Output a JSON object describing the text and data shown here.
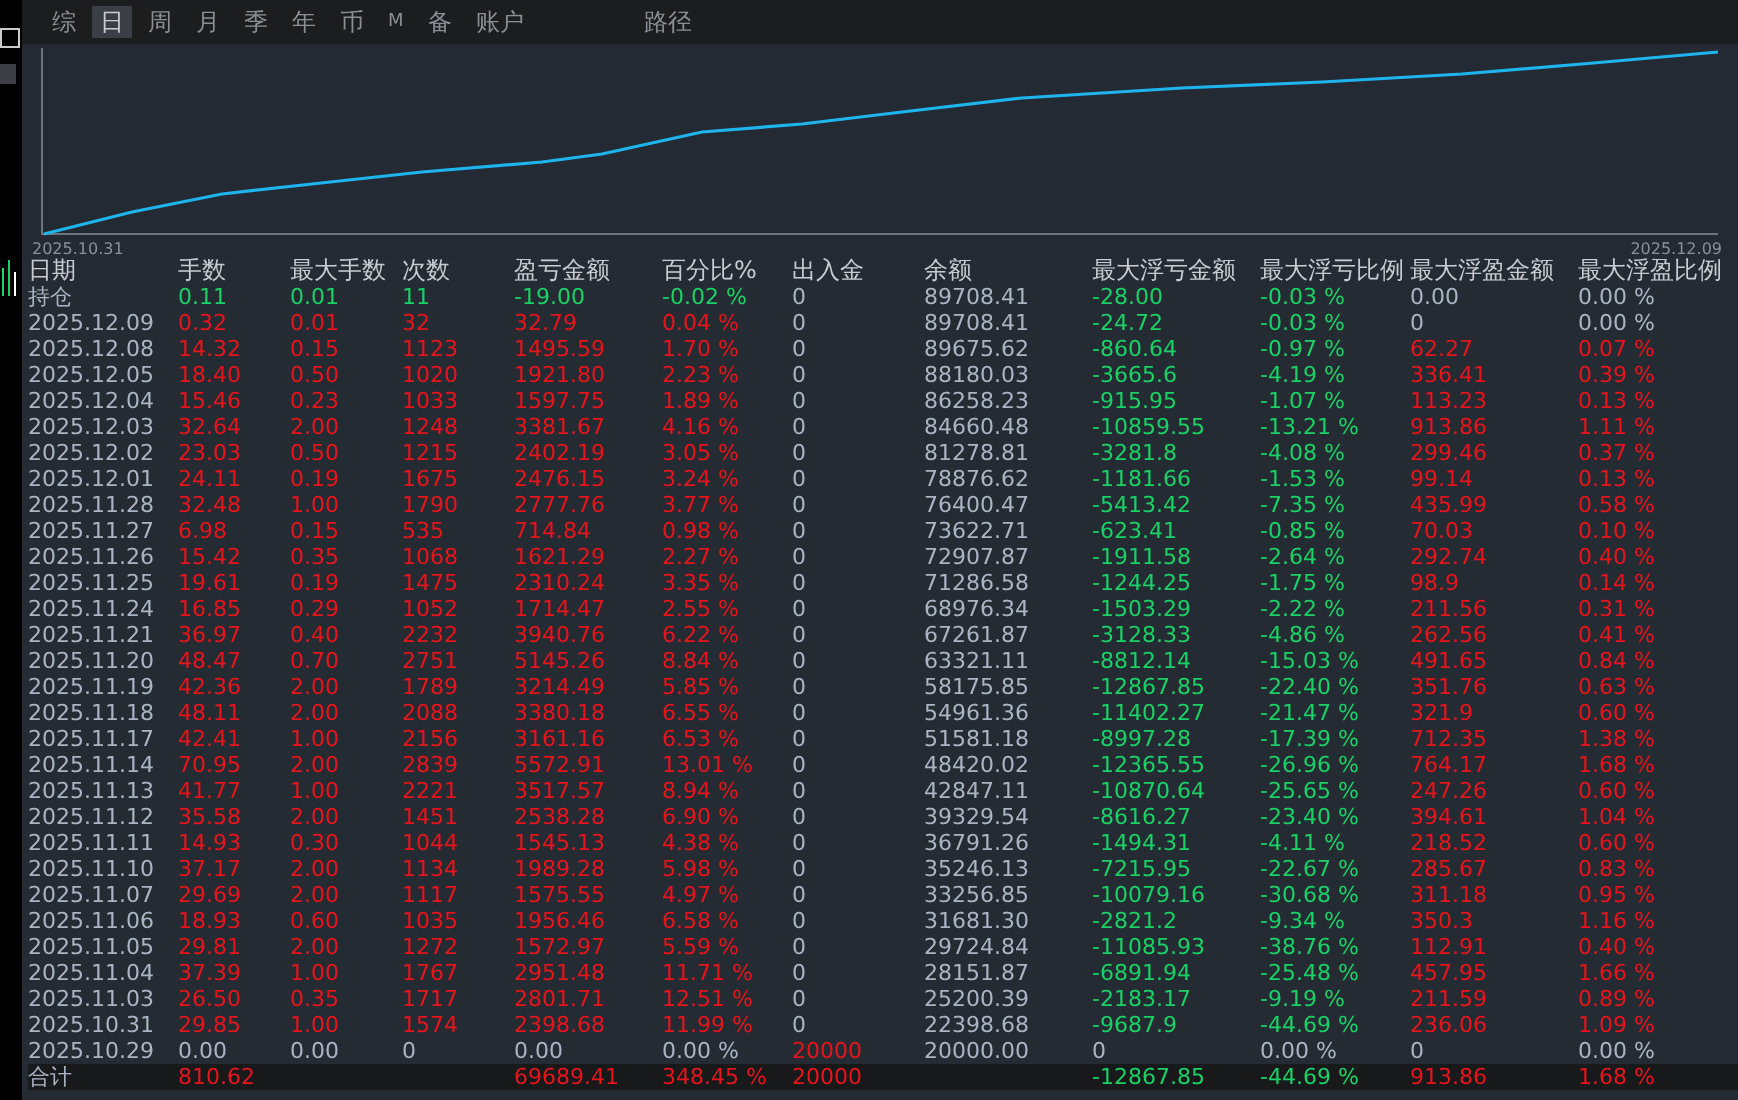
{
  "tabs": [
    {
      "label": "综",
      "selected": false
    },
    {
      "label": "日",
      "selected": true
    },
    {
      "label": "周",
      "selected": false
    },
    {
      "label": "月",
      "selected": false
    },
    {
      "label": "季",
      "selected": false
    },
    {
      "label": "年",
      "selected": false
    },
    {
      "label": "币",
      "selected": false
    },
    {
      "label": "M",
      "selected": false
    },
    {
      "label": "备",
      "selected": false
    },
    {
      "label": "账户",
      "selected": false
    }
  ],
  "path_tab": {
    "label": "路径",
    "selected": false
  },
  "chart": {
    "start_label": "2025.10.31",
    "end_label": "2025.12.09"
  },
  "table": {
    "columns": [
      "日期",
      "手数",
      "最大手数",
      "次数",
      "盈亏金额",
      "百分比%",
      "出入金",
      "余额",
      "最大浮亏金额",
      "最大浮亏比例",
      "最大浮盈金额",
      "最大浮盈比例"
    ],
    "rows": [
      {
        "cells": [
          {
            "text": "持仓",
            "color": "#aab4c4"
          },
          {
            "text": "0.11",
            "color": "#1ad166"
          },
          {
            "text": "0.01",
            "color": "#1ad166"
          },
          {
            "text": "11",
            "color": "#1ad166"
          },
          {
            "text": "-19.00",
            "color": "#1ad166"
          },
          {
            "text": "-0.02 %",
            "color": "#1ad166"
          },
          {
            "text": "0",
            "color": "#aab4c4"
          },
          {
            "text": "89708.41",
            "color": "#aab4c4"
          },
          {
            "text": "-28.00",
            "color": "#1ad166"
          },
          {
            "text": "-0.03 %",
            "color": "#1ad166"
          },
          {
            "text": "0.00",
            "color": "#aab4c4"
          },
          {
            "text": "0.00 %",
            "color": "#aab4c4"
          }
        ]
      },
      {
        "cells": [
          {
            "text": "2025.12.09",
            "color": "#aab4c4"
          },
          {
            "text": "0.32",
            "color": "#e8141c"
          },
          {
            "text": "0.01",
            "color": "#e8141c"
          },
          {
            "text": "32",
            "color": "#e8141c"
          },
          {
            "text": "32.79",
            "color": "#e8141c"
          },
          {
            "text": "0.04 %",
            "color": "#e8141c"
          },
          {
            "text": "0",
            "color": "#aab4c4"
          },
          {
            "text": "89708.41",
            "color": "#aab4c4"
          },
          {
            "text": "-24.72",
            "color": "#1ad166"
          },
          {
            "text": "-0.03 %",
            "color": "#1ad166"
          },
          {
            "text": "0",
            "color": "#aab4c4"
          },
          {
            "text": "0.00 %",
            "color": "#aab4c4"
          }
        ]
      },
      {
        "cells": [
          {
            "text": "2025.12.08",
            "color": "#aab4c4"
          },
          {
            "text": "14.32",
            "color": "#e8141c"
          },
          {
            "text": "0.15",
            "color": "#e8141c"
          },
          {
            "text": "1123",
            "color": "#e8141c"
          },
          {
            "text": "1495.59",
            "color": "#e8141c"
          },
          {
            "text": "1.70 %",
            "color": "#e8141c"
          },
          {
            "text": "0",
            "color": "#aab4c4"
          },
          {
            "text": "89675.62",
            "color": "#aab4c4"
          },
          {
            "text": "-860.64",
            "color": "#1ad166"
          },
          {
            "text": "-0.97 %",
            "color": "#1ad166"
          },
          {
            "text": "62.27",
            "color": "#e8141c"
          },
          {
            "text": "0.07 %",
            "color": "#e8141c"
          }
        ]
      },
      {
        "cells": [
          {
            "text": "2025.12.05",
            "color": "#aab4c4"
          },
          {
            "text": "18.40",
            "color": "#e8141c"
          },
          {
            "text": "0.50",
            "color": "#e8141c"
          },
          {
            "text": "1020",
            "color": "#e8141c"
          },
          {
            "text": "1921.80",
            "color": "#e8141c"
          },
          {
            "text": "2.23 %",
            "color": "#e8141c"
          },
          {
            "text": "0",
            "color": "#aab4c4"
          },
          {
            "text": "88180.03",
            "color": "#aab4c4"
          },
          {
            "text": "-3665.6",
            "color": "#1ad166"
          },
          {
            "text": "-4.19 %",
            "color": "#1ad166"
          },
          {
            "text": "336.41",
            "color": "#e8141c"
          },
          {
            "text": "0.39 %",
            "color": "#e8141c"
          }
        ]
      },
      {
        "cells": [
          {
            "text": "2025.12.04",
            "color": "#aab4c4"
          },
          {
            "text": "15.46",
            "color": "#e8141c"
          },
          {
            "text": "0.23",
            "color": "#e8141c"
          },
          {
            "text": "1033",
            "color": "#e8141c"
          },
          {
            "text": "1597.75",
            "color": "#e8141c"
          },
          {
            "text": "1.89 %",
            "color": "#e8141c"
          },
          {
            "text": "0",
            "color": "#aab4c4"
          },
          {
            "text": "86258.23",
            "color": "#aab4c4"
          },
          {
            "text": "-915.95",
            "color": "#1ad166"
          },
          {
            "text": "-1.07 %",
            "color": "#1ad166"
          },
          {
            "text": "113.23",
            "color": "#e8141c"
          },
          {
            "text": "0.13 %",
            "color": "#e8141c"
          }
        ]
      },
      {
        "cells": [
          {
            "text": "2025.12.03",
            "color": "#aab4c4"
          },
          {
            "text": "32.64",
            "color": "#e8141c"
          },
          {
            "text": "2.00",
            "color": "#e8141c"
          },
          {
            "text": "1248",
            "color": "#e8141c"
          },
          {
            "text": "3381.67",
            "color": "#e8141c"
          },
          {
            "text": "4.16 %",
            "color": "#e8141c"
          },
          {
            "text": "0",
            "color": "#aab4c4"
          },
          {
            "text": "84660.48",
            "color": "#aab4c4"
          },
          {
            "text": "-10859.55",
            "color": "#1ad166"
          },
          {
            "text": "-13.21 %",
            "color": "#1ad166"
          },
          {
            "text": "913.86",
            "color": "#e8141c"
          },
          {
            "text": "1.11 %",
            "color": "#e8141c"
          }
        ]
      },
      {
        "cells": [
          {
            "text": "2025.12.02",
            "color": "#aab4c4"
          },
          {
            "text": "23.03",
            "color": "#e8141c"
          },
          {
            "text": "0.50",
            "color": "#e8141c"
          },
          {
            "text": "1215",
            "color": "#e8141c"
          },
          {
            "text": "2402.19",
            "color": "#e8141c"
          },
          {
            "text": "3.05 %",
            "color": "#e8141c"
          },
          {
            "text": "0",
            "color": "#aab4c4"
          },
          {
            "text": "81278.81",
            "color": "#aab4c4"
          },
          {
            "text": "-3281.8",
            "color": "#1ad166"
          },
          {
            "text": "-4.08 %",
            "color": "#1ad166"
          },
          {
            "text": "299.46",
            "color": "#e8141c"
          },
          {
            "text": "0.37 %",
            "color": "#e8141c"
          }
        ]
      },
      {
        "cells": [
          {
            "text": "2025.12.01",
            "color": "#aab4c4"
          },
          {
            "text": "24.11",
            "color": "#e8141c"
          },
          {
            "text": "0.19",
            "color": "#e8141c"
          },
          {
            "text": "1675",
            "color": "#e8141c"
          },
          {
            "text": "2476.15",
            "color": "#e8141c"
          },
          {
            "text": "3.24 %",
            "color": "#e8141c"
          },
          {
            "text": "0",
            "color": "#aab4c4"
          },
          {
            "text": "78876.62",
            "color": "#aab4c4"
          },
          {
            "text": "-1181.66",
            "color": "#1ad166"
          },
          {
            "text": "-1.53 %",
            "color": "#1ad166"
          },
          {
            "text": "99.14",
            "color": "#e8141c"
          },
          {
            "text": "0.13 %",
            "color": "#e8141c"
          }
        ]
      },
      {
        "cells": [
          {
            "text": "2025.11.28",
            "color": "#aab4c4"
          },
          {
            "text": "32.48",
            "color": "#e8141c"
          },
          {
            "text": "1.00",
            "color": "#e8141c"
          },
          {
            "text": "1790",
            "color": "#e8141c"
          },
          {
            "text": "2777.76",
            "color": "#e8141c"
          },
          {
            "text": "3.77 %",
            "color": "#e8141c"
          },
          {
            "text": "0",
            "color": "#aab4c4"
          },
          {
            "text": "76400.47",
            "color": "#aab4c4"
          },
          {
            "text": "-5413.42",
            "color": "#1ad166"
          },
          {
            "text": "-7.35 %",
            "color": "#1ad166"
          },
          {
            "text": "435.99",
            "color": "#e8141c"
          },
          {
            "text": "0.58 %",
            "color": "#e8141c"
          }
        ]
      },
      {
        "cells": [
          {
            "text": "2025.11.27",
            "color": "#aab4c4"
          },
          {
            "text": "6.98",
            "color": "#e8141c"
          },
          {
            "text": "0.15",
            "color": "#e8141c"
          },
          {
            "text": "535",
            "color": "#e8141c"
          },
          {
            "text": "714.84",
            "color": "#e8141c"
          },
          {
            "text": "0.98 %",
            "color": "#e8141c"
          },
          {
            "text": "0",
            "color": "#aab4c4"
          },
          {
            "text": "73622.71",
            "color": "#aab4c4"
          },
          {
            "text": "-623.41",
            "color": "#1ad166"
          },
          {
            "text": "-0.85 %",
            "color": "#1ad166"
          },
          {
            "text": "70.03",
            "color": "#e8141c"
          },
          {
            "text": "0.10 %",
            "color": "#e8141c"
          }
        ]
      },
      {
        "cells": [
          {
            "text": "2025.11.26",
            "color": "#aab4c4"
          },
          {
            "text": "15.42",
            "color": "#e8141c"
          },
          {
            "text": "0.35",
            "color": "#e8141c"
          },
          {
            "text": "1068",
            "color": "#e8141c"
          },
          {
            "text": "1621.29",
            "color": "#e8141c"
          },
          {
            "text": "2.27 %",
            "color": "#e8141c"
          },
          {
            "text": "0",
            "color": "#aab4c4"
          },
          {
            "text": "72907.87",
            "color": "#aab4c4"
          },
          {
            "text": "-1911.58",
            "color": "#1ad166"
          },
          {
            "text": "-2.64 %",
            "color": "#1ad166"
          },
          {
            "text": "292.74",
            "color": "#e8141c"
          },
          {
            "text": "0.40 %",
            "color": "#e8141c"
          }
        ]
      },
      {
        "cells": [
          {
            "text": "2025.11.25",
            "color": "#aab4c4"
          },
          {
            "text": "19.61",
            "color": "#e8141c"
          },
          {
            "text": "0.19",
            "color": "#e8141c"
          },
          {
            "text": "1475",
            "color": "#e8141c"
          },
          {
            "text": "2310.24",
            "color": "#e8141c"
          },
          {
            "text": "3.35 %",
            "color": "#e8141c"
          },
          {
            "text": "0",
            "color": "#aab4c4"
          },
          {
            "text": "71286.58",
            "color": "#aab4c4"
          },
          {
            "text": "-1244.25",
            "color": "#1ad166"
          },
          {
            "text": "-1.75 %",
            "color": "#1ad166"
          },
          {
            "text": "98.9",
            "color": "#e8141c"
          },
          {
            "text": "0.14 %",
            "color": "#e8141c"
          }
        ]
      },
      {
        "cells": [
          {
            "text": "2025.11.24",
            "color": "#aab4c4"
          },
          {
            "text": "16.85",
            "color": "#e8141c"
          },
          {
            "text": "0.29",
            "color": "#e8141c"
          },
          {
            "text": "1052",
            "color": "#e8141c"
          },
          {
            "text": "1714.47",
            "color": "#e8141c"
          },
          {
            "text": "2.55 %",
            "color": "#e8141c"
          },
          {
            "text": "0",
            "color": "#aab4c4"
          },
          {
            "text": "68976.34",
            "color": "#aab4c4"
          },
          {
            "text": "-1503.29",
            "color": "#1ad166"
          },
          {
            "text": "-2.22 %",
            "color": "#1ad166"
          },
          {
            "text": "211.56",
            "color": "#e8141c"
          },
          {
            "text": "0.31 %",
            "color": "#e8141c"
          }
        ]
      },
      {
        "cells": [
          {
            "text": "2025.11.21",
            "color": "#aab4c4"
          },
          {
            "text": "36.97",
            "color": "#e8141c"
          },
          {
            "text": "0.40",
            "color": "#e8141c"
          },
          {
            "text": "2232",
            "color": "#e8141c"
          },
          {
            "text": "3940.76",
            "color": "#e8141c"
          },
          {
            "text": "6.22 %",
            "color": "#e8141c"
          },
          {
            "text": "0",
            "color": "#aab4c4"
          },
          {
            "text": "67261.87",
            "color": "#aab4c4"
          },
          {
            "text": "-3128.33",
            "color": "#1ad166"
          },
          {
            "text": "-4.86 %",
            "color": "#1ad166"
          },
          {
            "text": "262.56",
            "color": "#e8141c"
          },
          {
            "text": "0.41 %",
            "color": "#e8141c"
          }
        ]
      },
      {
        "cells": [
          {
            "text": "2025.11.20",
            "color": "#aab4c4"
          },
          {
            "text": "48.47",
            "color": "#e8141c"
          },
          {
            "text": "0.70",
            "color": "#e8141c"
          },
          {
            "text": "2751",
            "color": "#e8141c"
          },
          {
            "text": "5145.26",
            "color": "#e8141c"
          },
          {
            "text": "8.84 %",
            "color": "#e8141c"
          },
          {
            "text": "0",
            "color": "#aab4c4"
          },
          {
            "text": "63321.11",
            "color": "#aab4c4"
          },
          {
            "text": "-8812.14",
            "color": "#1ad166"
          },
          {
            "text": "-15.03 %",
            "color": "#1ad166"
          },
          {
            "text": "491.65",
            "color": "#e8141c"
          },
          {
            "text": "0.84 %",
            "color": "#e8141c"
          }
        ]
      },
      {
        "cells": [
          {
            "text": "2025.11.19",
            "color": "#aab4c4"
          },
          {
            "text": "42.36",
            "color": "#e8141c"
          },
          {
            "text": "2.00",
            "color": "#e8141c"
          },
          {
            "text": "1789",
            "color": "#e8141c"
          },
          {
            "text": "3214.49",
            "color": "#e8141c"
          },
          {
            "text": "5.85 %",
            "color": "#e8141c"
          },
          {
            "text": "0",
            "color": "#aab4c4"
          },
          {
            "text": "58175.85",
            "color": "#aab4c4"
          },
          {
            "text": "-12867.85",
            "color": "#1ad166"
          },
          {
            "text": "-22.40 %",
            "color": "#1ad166"
          },
          {
            "text": "351.76",
            "color": "#e8141c"
          },
          {
            "text": "0.63 %",
            "color": "#e8141c"
          }
        ]
      },
      {
        "cells": [
          {
            "text": "2025.11.18",
            "color": "#aab4c4"
          },
          {
            "text": "48.11",
            "color": "#e8141c"
          },
          {
            "text": "2.00",
            "color": "#e8141c"
          },
          {
            "text": "2088",
            "color": "#e8141c"
          },
          {
            "text": "3380.18",
            "color": "#e8141c"
          },
          {
            "text": "6.55 %",
            "color": "#e8141c"
          },
          {
            "text": "0",
            "color": "#aab4c4"
          },
          {
            "text": "54961.36",
            "color": "#aab4c4"
          },
          {
            "text": "-11402.27",
            "color": "#1ad166"
          },
          {
            "text": "-21.47 %",
            "color": "#1ad166"
          },
          {
            "text": "321.9",
            "color": "#e8141c"
          },
          {
            "text": "0.60 %",
            "color": "#e8141c"
          }
        ]
      },
      {
        "cells": [
          {
            "text": "2025.11.17",
            "color": "#aab4c4"
          },
          {
            "text": "42.41",
            "color": "#e8141c"
          },
          {
            "text": "1.00",
            "color": "#e8141c"
          },
          {
            "text": "2156",
            "color": "#e8141c"
          },
          {
            "text": "3161.16",
            "color": "#e8141c"
          },
          {
            "text": "6.53 %",
            "color": "#e8141c"
          },
          {
            "text": "0",
            "color": "#aab4c4"
          },
          {
            "text": "51581.18",
            "color": "#aab4c4"
          },
          {
            "text": "-8997.28",
            "color": "#1ad166"
          },
          {
            "text": "-17.39 %",
            "color": "#1ad166"
          },
          {
            "text": "712.35",
            "color": "#e8141c"
          },
          {
            "text": "1.38 %",
            "color": "#e8141c"
          }
        ]
      },
      {
        "cells": [
          {
            "text": "2025.11.14",
            "color": "#aab4c4"
          },
          {
            "text": "70.95",
            "color": "#e8141c"
          },
          {
            "text": "2.00",
            "color": "#e8141c"
          },
          {
            "text": "2839",
            "color": "#e8141c"
          },
          {
            "text": "5572.91",
            "color": "#e8141c"
          },
          {
            "text": "13.01 %",
            "color": "#e8141c"
          },
          {
            "text": "0",
            "color": "#aab4c4"
          },
          {
            "text": "48420.02",
            "color": "#aab4c4"
          },
          {
            "text": "-12365.55",
            "color": "#1ad166"
          },
          {
            "text": "-26.96 %",
            "color": "#1ad166"
          },
          {
            "text": "764.17",
            "color": "#e8141c"
          },
          {
            "text": "1.68 %",
            "color": "#e8141c"
          }
        ]
      },
      {
        "cells": [
          {
            "text": "2025.11.13",
            "color": "#aab4c4"
          },
          {
            "text": "41.77",
            "color": "#e8141c"
          },
          {
            "text": "1.00",
            "color": "#e8141c"
          },
          {
            "text": "2221",
            "color": "#e8141c"
          },
          {
            "text": "3517.57",
            "color": "#e8141c"
          },
          {
            "text": "8.94 %",
            "color": "#e8141c"
          },
          {
            "text": "0",
            "color": "#aab4c4"
          },
          {
            "text": "42847.11",
            "color": "#aab4c4"
          },
          {
            "text": "-10870.64",
            "color": "#1ad166"
          },
          {
            "text": "-25.65 %",
            "color": "#1ad166"
          },
          {
            "text": "247.26",
            "color": "#e8141c"
          },
          {
            "text": "0.60 %",
            "color": "#e8141c"
          }
        ]
      },
      {
        "cells": [
          {
            "text": "2025.11.12",
            "color": "#aab4c4"
          },
          {
            "text": "35.58",
            "color": "#e8141c"
          },
          {
            "text": "2.00",
            "color": "#e8141c"
          },
          {
            "text": "1451",
            "color": "#e8141c"
          },
          {
            "text": "2538.28",
            "color": "#e8141c"
          },
          {
            "text": "6.90 %",
            "color": "#e8141c"
          },
          {
            "text": "0",
            "color": "#aab4c4"
          },
          {
            "text": "39329.54",
            "color": "#aab4c4"
          },
          {
            "text": "-8616.27",
            "color": "#1ad166"
          },
          {
            "text": "-23.40 %",
            "color": "#1ad166"
          },
          {
            "text": "394.61",
            "color": "#e8141c"
          },
          {
            "text": "1.04 %",
            "color": "#e8141c"
          }
        ]
      },
      {
        "cells": [
          {
            "text": "2025.11.11",
            "color": "#aab4c4"
          },
          {
            "text": "14.93",
            "color": "#e8141c"
          },
          {
            "text": "0.30",
            "color": "#e8141c"
          },
          {
            "text": "1044",
            "color": "#e8141c"
          },
          {
            "text": "1545.13",
            "color": "#e8141c"
          },
          {
            "text": "4.38 %",
            "color": "#e8141c"
          },
          {
            "text": "0",
            "color": "#aab4c4"
          },
          {
            "text": "36791.26",
            "color": "#aab4c4"
          },
          {
            "text": "-1494.31",
            "color": "#1ad166"
          },
          {
            "text": "-4.11 %",
            "color": "#1ad166"
          },
          {
            "text": "218.52",
            "color": "#e8141c"
          },
          {
            "text": "0.60 %",
            "color": "#e8141c"
          }
        ]
      },
      {
        "cells": [
          {
            "text": "2025.11.10",
            "color": "#aab4c4"
          },
          {
            "text": "37.17",
            "color": "#e8141c"
          },
          {
            "text": "2.00",
            "color": "#e8141c"
          },
          {
            "text": "1134",
            "color": "#e8141c"
          },
          {
            "text": "1989.28",
            "color": "#e8141c"
          },
          {
            "text": "5.98 %",
            "color": "#e8141c"
          },
          {
            "text": "0",
            "color": "#aab4c4"
          },
          {
            "text": "35246.13",
            "color": "#aab4c4"
          },
          {
            "text": "-7215.95",
            "color": "#1ad166"
          },
          {
            "text": "-22.67 %",
            "color": "#1ad166"
          },
          {
            "text": "285.67",
            "color": "#e8141c"
          },
          {
            "text": "0.83 %",
            "color": "#e8141c"
          }
        ]
      },
      {
        "cells": [
          {
            "text": "2025.11.07",
            "color": "#aab4c4"
          },
          {
            "text": "29.69",
            "color": "#e8141c"
          },
          {
            "text": "2.00",
            "color": "#e8141c"
          },
          {
            "text": "1117",
            "color": "#e8141c"
          },
          {
            "text": "1575.55",
            "color": "#e8141c"
          },
          {
            "text": "4.97 %",
            "color": "#e8141c"
          },
          {
            "text": "0",
            "color": "#aab4c4"
          },
          {
            "text": "33256.85",
            "color": "#aab4c4"
          },
          {
            "text": "-10079.16",
            "color": "#1ad166"
          },
          {
            "text": "-30.68 %",
            "color": "#1ad166"
          },
          {
            "text": "311.18",
            "color": "#e8141c"
          },
          {
            "text": "0.95 %",
            "color": "#e8141c"
          }
        ]
      },
      {
        "cells": [
          {
            "text": "2025.11.06",
            "color": "#aab4c4"
          },
          {
            "text": "18.93",
            "color": "#e8141c"
          },
          {
            "text": "0.60",
            "color": "#e8141c"
          },
          {
            "text": "1035",
            "color": "#e8141c"
          },
          {
            "text": "1956.46",
            "color": "#e8141c"
          },
          {
            "text": "6.58 %",
            "color": "#e8141c"
          },
          {
            "text": "0",
            "color": "#aab4c4"
          },
          {
            "text": "31681.30",
            "color": "#aab4c4"
          },
          {
            "text": "-2821.2",
            "color": "#1ad166"
          },
          {
            "text": "-9.34 %",
            "color": "#1ad166"
          },
          {
            "text": "350.3",
            "color": "#e8141c"
          },
          {
            "text": "1.16 %",
            "color": "#e8141c"
          }
        ]
      },
      {
        "cells": [
          {
            "text": "2025.11.05",
            "color": "#aab4c4"
          },
          {
            "text": "29.81",
            "color": "#e8141c"
          },
          {
            "text": "2.00",
            "color": "#e8141c"
          },
          {
            "text": "1272",
            "color": "#e8141c"
          },
          {
            "text": "1572.97",
            "color": "#e8141c"
          },
          {
            "text": "5.59 %",
            "color": "#e8141c"
          },
          {
            "text": "0",
            "color": "#aab4c4"
          },
          {
            "text": "29724.84",
            "color": "#aab4c4"
          },
          {
            "text": "-11085.93",
            "color": "#1ad166"
          },
          {
            "text": "-38.76 %",
            "color": "#1ad166"
          },
          {
            "text": "112.91",
            "color": "#e8141c"
          },
          {
            "text": "0.40 %",
            "color": "#e8141c"
          }
        ]
      },
      {
        "cells": [
          {
            "text": "2025.11.04",
            "color": "#aab4c4"
          },
          {
            "text": "37.39",
            "color": "#e8141c"
          },
          {
            "text": "1.00",
            "color": "#e8141c"
          },
          {
            "text": "1767",
            "color": "#e8141c"
          },
          {
            "text": "2951.48",
            "color": "#e8141c"
          },
          {
            "text": "11.71 %",
            "color": "#e8141c"
          },
          {
            "text": "0",
            "color": "#aab4c4"
          },
          {
            "text": "28151.87",
            "color": "#aab4c4"
          },
          {
            "text": "-6891.94",
            "color": "#1ad166"
          },
          {
            "text": "-25.48 %",
            "color": "#1ad166"
          },
          {
            "text": "457.95",
            "color": "#e8141c"
          },
          {
            "text": "1.66 %",
            "color": "#e8141c"
          }
        ]
      },
      {
        "cells": [
          {
            "text": "2025.11.03",
            "color": "#aab4c4"
          },
          {
            "text": "26.50",
            "color": "#e8141c"
          },
          {
            "text": "0.35",
            "color": "#e8141c"
          },
          {
            "text": "1717",
            "color": "#e8141c"
          },
          {
            "text": "2801.71",
            "color": "#e8141c"
          },
          {
            "text": "12.51 %",
            "color": "#e8141c"
          },
          {
            "text": "0",
            "color": "#aab4c4"
          },
          {
            "text": "25200.39",
            "color": "#aab4c4"
          },
          {
            "text": "-2183.17",
            "color": "#1ad166"
          },
          {
            "text": "-9.19 %",
            "color": "#1ad166"
          },
          {
            "text": "211.59",
            "color": "#e8141c"
          },
          {
            "text": "0.89 %",
            "color": "#e8141c"
          }
        ]
      },
      {
        "cells": [
          {
            "text": "2025.10.31",
            "color": "#aab4c4"
          },
          {
            "text": "29.85",
            "color": "#e8141c"
          },
          {
            "text": "1.00",
            "color": "#e8141c"
          },
          {
            "text": "1574",
            "color": "#e8141c"
          },
          {
            "text": "2398.68",
            "color": "#e8141c"
          },
          {
            "text": "11.99 %",
            "color": "#e8141c"
          },
          {
            "text": "0",
            "color": "#aab4c4"
          },
          {
            "text": "22398.68",
            "color": "#aab4c4"
          },
          {
            "text": "-9687.9",
            "color": "#1ad166"
          },
          {
            "text": "-44.69 %",
            "color": "#1ad166"
          },
          {
            "text": "236.06",
            "color": "#e8141c"
          },
          {
            "text": "1.09 %",
            "color": "#e8141c"
          }
        ]
      },
      {
        "cells": [
          {
            "text": "2025.10.29",
            "color": "#aab4c4"
          },
          {
            "text": "0.00",
            "color": "#aab4c4"
          },
          {
            "text": "0.00",
            "color": "#aab4c4"
          },
          {
            "text": "0",
            "color": "#aab4c4"
          },
          {
            "text": "0.00",
            "color": "#aab4c4"
          },
          {
            "text": "0.00 %",
            "color": "#aab4c4"
          },
          {
            "text": "20000",
            "color": "#e8141c"
          },
          {
            "text": "20000.00",
            "color": "#aab4c4"
          },
          {
            "text": "0",
            "color": "#aab4c4"
          },
          {
            "text": "0.00 %",
            "color": "#aab4c4"
          },
          {
            "text": "0",
            "color": "#aab4c4"
          },
          {
            "text": "0.00 %",
            "color": "#aab4c4"
          }
        ]
      }
    ],
    "total": {
      "cells": [
        {
          "text": "合计",
          "color": "#aab4c4"
        },
        {
          "text": "810.62",
          "color": "#e8141c"
        },
        {},
        {},
        {
          "text": "69689.41",
          "color": "#e8141c"
        },
        {
          "text": "348.45 %",
          "color": "#e8141c"
        },
        {
          "text": "20000",
          "color": "#e8141c"
        },
        {},
        {
          "text": "-12867.85",
          "color": "#1ad166"
        },
        {
          "text": "-44.69 %",
          "color": "#1ad166"
        },
        {
          "text": "913.86",
          "color": "#e8141c"
        },
        {
          "text": "1.68 %",
          "color": "#e8141c"
        }
      ]
    }
  }
}
